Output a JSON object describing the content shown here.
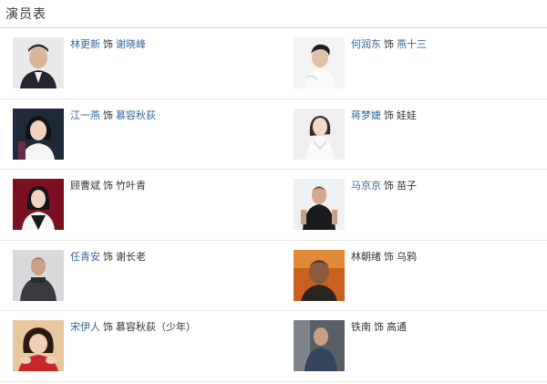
{
  "section_title": "演员表",
  "as_word": "饰",
  "cast": [
    [
      {
        "actor": "林更新",
        "role": "谢晓峰",
        "actor_link": true,
        "role_link": true,
        "photo": "portrait-man-suit"
      },
      {
        "actor": "何润东",
        "role": "燕十三",
        "actor_link": true,
        "role_link": true,
        "photo": "portrait-man-white"
      }
    ],
    [
      {
        "actor": "江一燕",
        "role": "慕容秋荻",
        "actor_link": true,
        "role_link": true,
        "photo": "portrait-woman-dark"
      },
      {
        "actor": "蒋梦婕",
        "role": "娃娃",
        "actor_link": true,
        "role_link": false,
        "photo": "portrait-woman-white"
      }
    ],
    [
      {
        "actor": "顾曹斌",
        "role": "竹叶青",
        "actor_link": false,
        "role_link": false,
        "photo": "portrait-woman-red"
      },
      {
        "actor": "马京京",
        "role": "苗子",
        "actor_link": true,
        "role_link": false,
        "photo": "portrait-man-black"
      }
    ],
    [
      {
        "actor": "任青安",
        "role": "谢长老",
        "actor_link": true,
        "role_link": false,
        "photo": "portrait-man-grey"
      },
      {
        "actor": "林朝绪",
        "role": "乌鸦",
        "actor_link": false,
        "role_link": false,
        "photo": "portrait-man-orange"
      }
    ],
    [
      {
        "actor": "宋伊人",
        "role": "慕容秋荻（少年）",
        "actor_link": true,
        "role_link": false,
        "photo": "portrait-girl-red"
      },
      {
        "actor": "铁南",
        "role": "高通",
        "actor_link": false,
        "role_link": false,
        "photo": "portrait-man-denim"
      }
    ]
  ]
}
